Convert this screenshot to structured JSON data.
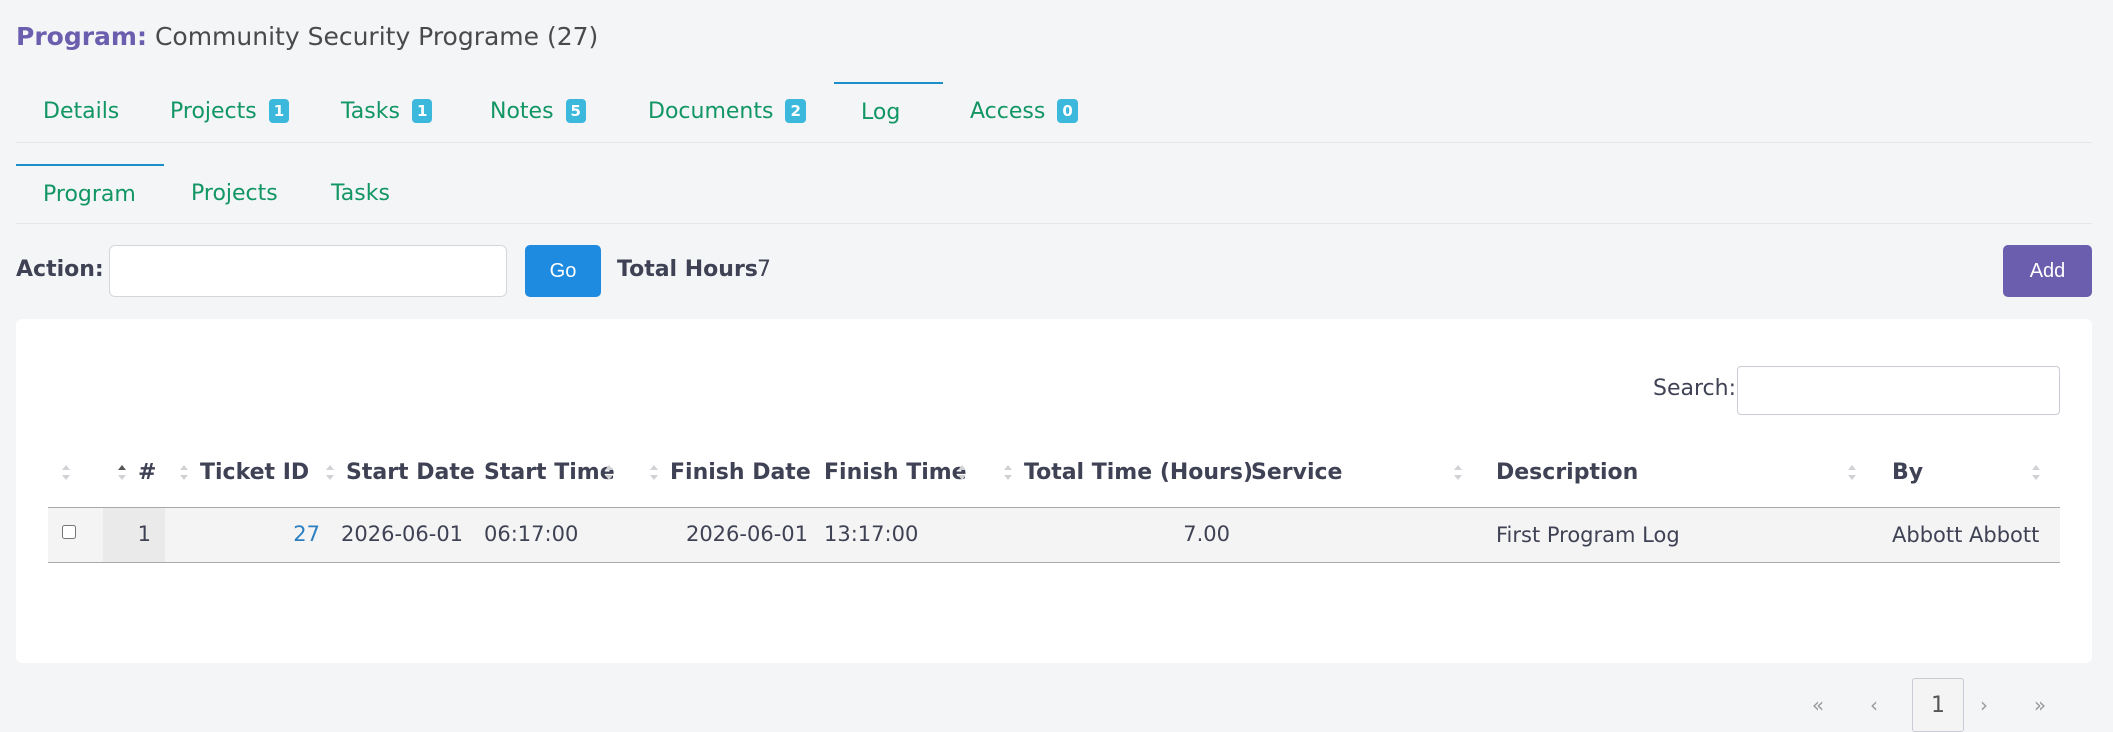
{
  "header": {
    "program_label": "Program:",
    "program_name": "Community Security Programe (27)"
  },
  "tabs": [
    {
      "label": "Details",
      "badge": ""
    },
    {
      "label": "Projects",
      "badge": "1"
    },
    {
      "label": "Tasks",
      "badge": "1"
    },
    {
      "label": "Notes",
      "badge": "5"
    },
    {
      "label": "Documents",
      "badge": "2"
    },
    {
      "label": "Log",
      "badge": "",
      "active": true
    },
    {
      "label": "Access",
      "badge": "0"
    }
  ],
  "subtabs": [
    {
      "label": "Program",
      "active": true
    },
    {
      "label": "Projects"
    },
    {
      "label": "Tasks"
    }
  ],
  "toolbar": {
    "action_label": "Action:",
    "action_value": "",
    "go_label": "Go",
    "total_hours_label": "Total Hours",
    "total_hours_value": "7",
    "add_label": "Add"
  },
  "table": {
    "search_label": "Search:",
    "search_value": "",
    "columns": [
      "#",
      "Ticket ID",
      "Start Date",
      "Start Time",
      "Finish Date",
      "Finish Time",
      "Total Time (Hours)",
      "Service",
      "Description",
      "By"
    ],
    "rows": [
      {
        "index": "1",
        "ticket_id": "27",
        "start_date": "2026-06-01",
        "start_time": "06:17:00",
        "finish_date": "2026-06-01",
        "finish_time": "13:17:00",
        "total_time": "7.00",
        "service": "",
        "description": "First Program Log",
        "by": "Abbott Abbott"
      }
    ]
  },
  "pagination": {
    "first": "«",
    "prev": "‹",
    "current": "1",
    "next": "›",
    "last": "»"
  },
  "colors": {
    "accent_purple": "#6b5eae",
    "tab_green": "#129664",
    "badge_blue": "#3bb8dc",
    "go_blue": "#1e8ae0",
    "link_blue": "#2b7fc1"
  }
}
